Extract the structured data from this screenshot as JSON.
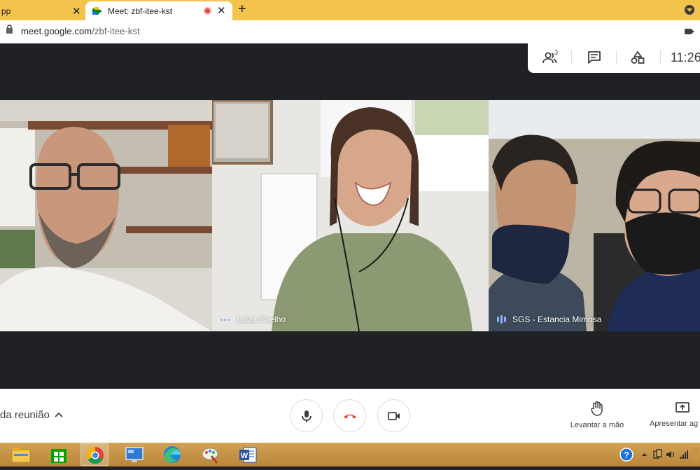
{
  "browser": {
    "tabs": [
      {
        "title": "pp",
        "active": false
      },
      {
        "title": "Meet: zbf-itee-kst",
        "active": true,
        "recording": true
      }
    ],
    "new_tab_label": "+",
    "url_host": "meet.google.com",
    "url_path": "/zbf-itee-kst"
  },
  "meet": {
    "top_bar": {
      "participants_count": "3",
      "time": "11:26",
      "icons": [
        "people-icon",
        "chat-icon",
        "activities-icon"
      ]
    },
    "tiles": [
      {
        "name": "",
        "indicator": "none"
      },
      {
        "name": "Luiza Coelho",
        "indicator": "dots"
      },
      {
        "name": "SGS - Estancia Mimosa",
        "indicator": "speaking-bars"
      }
    ],
    "bottom_bar": {
      "meeting_details": "da reunião",
      "controls": [
        "microphone-icon",
        "hangup-icon",
        "camera-icon"
      ],
      "raise_hand": "Levantar a mão",
      "present": "Apresentar ag"
    },
    "colors": {
      "accent_blue": "#8ab4f8",
      "hangup_red": "#ea4335",
      "tab_bar": "#f3c34c"
    }
  },
  "taskbar": {
    "apps": [
      "file-explorer-icon",
      "store-icon",
      "chrome-icon",
      "control-panel-icon",
      "edge-icon",
      "paint-icon",
      "word-icon"
    ],
    "tray_icons": [
      "help-icon",
      "show-hidden-icon",
      "network-icon",
      "volume-icon",
      "signal-icon"
    ]
  }
}
